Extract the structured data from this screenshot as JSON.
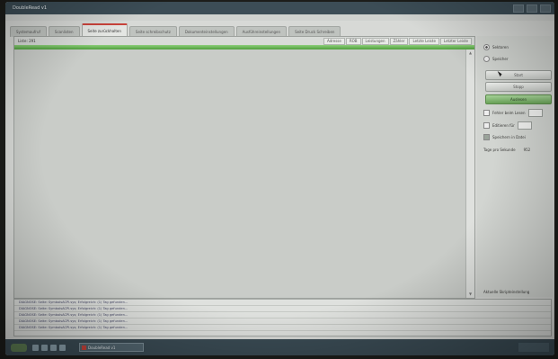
{
  "window": {
    "title": "DoubleRead v1"
  },
  "menu": [],
  "tabs": [
    {
      "label": "Systemaufruf",
      "active": false
    },
    {
      "label": "Scanlisten",
      "active": false
    },
    {
      "label": "Seite zurückhalten",
      "active": true
    },
    {
      "label": "Seite schreibschutz",
      "active": false
    },
    {
      "label": "Dokumenteinstellungen",
      "active": false
    },
    {
      "label": "Ausführeinstellungen",
      "active": false
    },
    {
      "label": "Seite Druck Schreiben",
      "active": false
    }
  ],
  "main": {
    "info_label": "Liste: 291",
    "columns": [
      "Adresse",
      "ROB",
      "Leistungen",
      "Zähler",
      "Letzte Leiste",
      "Letzter Leiste"
    ],
    "progress": 1.0
  },
  "side": {
    "radio_1": "Sektoren",
    "radio_2": "Speicher",
    "btn_1": "Start",
    "btn_2": "Stopp",
    "btn_3": "Auslesen",
    "chk_1": "Fehler beim Lesen",
    "chk_2": "Editieren für",
    "chk_3": "Speichern in Datei",
    "speed_label": "Tage pro Sekunde",
    "speed_value": "952",
    "bottom_link": "Aktuelle Skripteinstellung"
  },
  "log": [
    "DIAGNOSE: Seite: SymbolsACPI.sys; Erfolgreich: (1) Tag gefunden...",
    "DIAGNOSE: Seite: SymbolsACPI.sys; Erfolgreich: (1) Tag gefunden...",
    "DIAGNOSE: Seite: SymbolsACPI.sys; Erfolgreich: (1) Tag gefunden...",
    "DIAGNOSE: Seite: SymbolsACPI.sys; Erfolgreich: (1) Tag gefunden...",
    "DIAGNOSE: Seite: SymbolsACPI.sys; Erfolgreich: (1) Tag gefunden..."
  ],
  "taskbar": {
    "task_label": "DoubleRead v1",
    "clock": ""
  },
  "colors": {
    "accent_tab": "#c8423a",
    "progress": "#4f9f3d",
    "titlebar": "#3c4d56"
  }
}
